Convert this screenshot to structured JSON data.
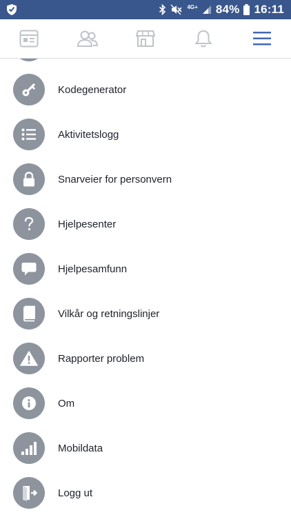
{
  "status_bar": {
    "network": "4G+",
    "battery": "84%",
    "time": "16:11"
  },
  "tabs": [
    {
      "icon": "news-feed-icon"
    },
    {
      "icon": "friends-icon"
    },
    {
      "icon": "marketplace-icon"
    },
    {
      "icon": "notifications-icon"
    },
    {
      "icon": "menu-icon",
      "active": true
    }
  ],
  "colors": {
    "status_bar": "#39578c",
    "active_tab": "#4267b2",
    "inactive_tab": "#bec3c9",
    "icon_circle": "#8d949e",
    "label": "#1d2129"
  },
  "menu": {
    "items": [
      {
        "label": "Kodegenerator",
        "icon": "key-icon"
      },
      {
        "label": "Aktivitetslogg",
        "icon": "list-icon"
      },
      {
        "label": "Snarveier for personvern",
        "icon": "lock-icon"
      },
      {
        "label": "Hjelpesenter",
        "icon": "question-icon"
      },
      {
        "label": "Hjelpesamfunn",
        "icon": "speech-bubble-icon"
      },
      {
        "label": "Vilkår og retningslinjer",
        "icon": "book-icon"
      },
      {
        "label": "Rapporter problem",
        "icon": "warning-icon"
      },
      {
        "label": "Om",
        "icon": "info-icon"
      },
      {
        "label": "Mobildata",
        "icon": "signal-bars-icon"
      },
      {
        "label": "Logg ut",
        "icon": "logout-icon"
      }
    ]
  }
}
